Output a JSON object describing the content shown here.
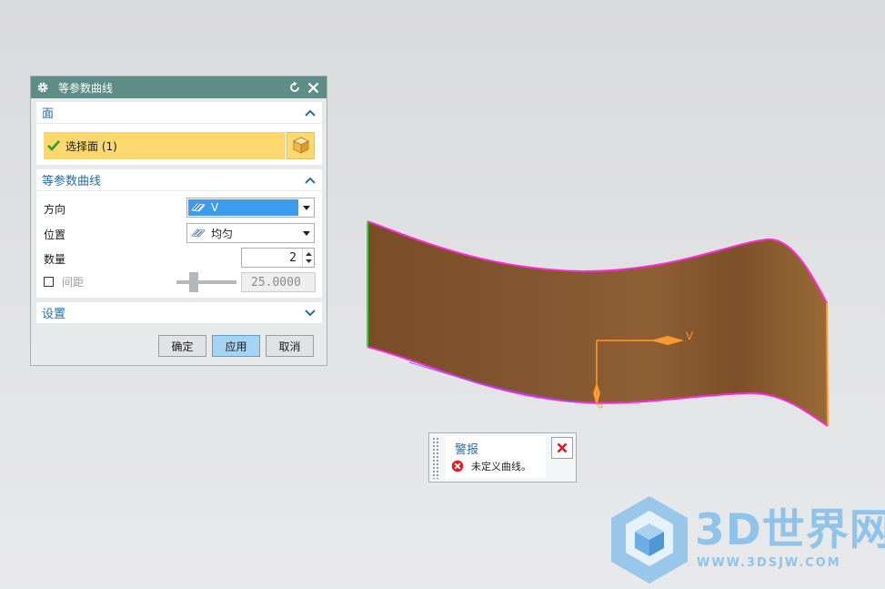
{
  "dialog": {
    "title": "等参数曲线",
    "face_section": {
      "header": "面",
      "select_face_label": "选择面 (1)"
    },
    "iso_section": {
      "header": "等参数曲线",
      "direction_label": "方向",
      "direction_value": "V",
      "position_label": "位置",
      "position_value": "均匀",
      "count_label": "数量",
      "count_value": "2",
      "spacing_label": "间距",
      "spacing_value": "25.0000"
    },
    "settings_section": {
      "header": "设置"
    },
    "buttons": {
      "ok": "确定",
      "apply": "应用",
      "cancel": "取消"
    }
  },
  "viewport": {
    "axis_label": "V",
    "surface_color": "#8a5a2e",
    "edge_color": "#ff2bd6"
  },
  "alert": {
    "title": "警报",
    "message": "未定义曲线。"
  },
  "watermark": {
    "brand": "3D世界网",
    "url": "WWW.3DSJW.COM"
  },
  "colors": {
    "title_bar": "#5e8c87",
    "section_header": "#2b6c9c",
    "selection_highlight": "#fdd86e",
    "selected_item": "#3d9bf0"
  }
}
